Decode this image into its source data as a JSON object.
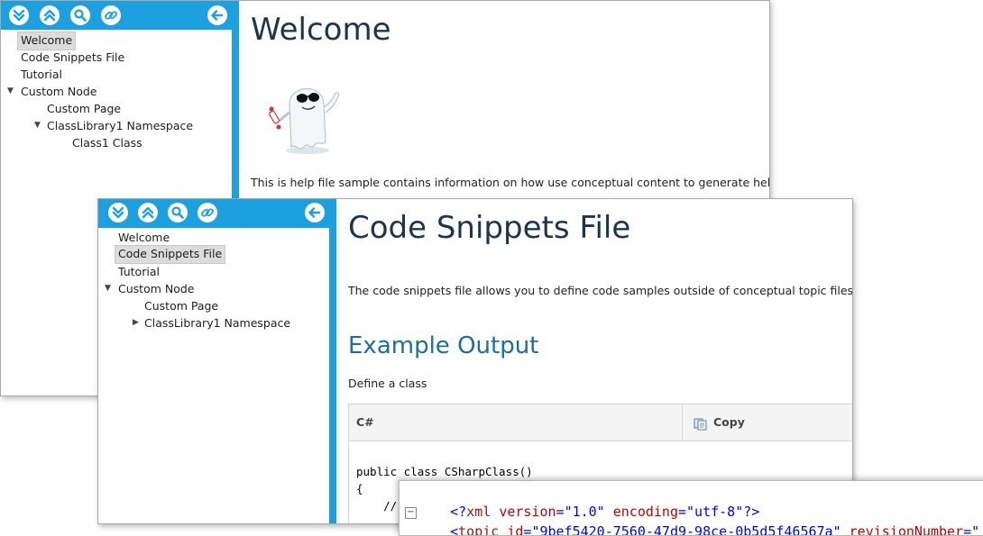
{
  "window_back": {
    "toolbar": {
      "buttons": [
        {
          "icon": "expand-all-icon"
        },
        {
          "icon": "collapse-all-icon"
        },
        {
          "icon": "search-icon"
        },
        {
          "icon": "link-icon"
        }
      ],
      "back_icon": "back-arrow-icon"
    },
    "tree": [
      {
        "label": "Welcome",
        "selected": true
      },
      {
        "label": "Code Snippets File"
      },
      {
        "label": "Tutorial"
      },
      {
        "label": "Custom Node",
        "expanded": true
      },
      {
        "label": "Custom Page"
      },
      {
        "label": "ClassLibrary1 Namespace",
        "expanded": true
      },
      {
        "label": "Class1 Class"
      }
    ],
    "content": {
      "title": "Welcome",
      "image": "ghost-mascot",
      "paragraph": "This is help file sample contains information on how use conceptual content to generate help file."
    }
  },
  "window_front": {
    "toolbar": {
      "buttons": [
        {
          "icon": "expand-all-icon"
        },
        {
          "icon": "collapse-all-icon"
        },
        {
          "icon": "search-icon"
        },
        {
          "icon": "link-icon"
        }
      ],
      "back_icon": "back-arrow-icon"
    },
    "tree": [
      {
        "label": "Welcome"
      },
      {
        "label": "Code Snippets File",
        "selected": true
      },
      {
        "label": "Tutorial"
      },
      {
        "label": "Custom Node",
        "expanded": true
      },
      {
        "label": "Custom Page"
      },
      {
        "label": "ClassLibrary1 Namespace",
        "expanded": false
      }
    ],
    "content": {
      "title": "Code Snippets File",
      "intro": "The code snippets file allows you to define code samples outside of conceptual topic files.",
      "section_title": "Example Output",
      "section_text": "Define a class",
      "code_block": {
        "language": "C#",
        "copy_label": "Copy",
        "lines": [
          "public class CSharpClass()",
          "{",
          "    //"
        ]
      }
    }
  },
  "xml_window": {
    "line1": {
      "open": "<?",
      "name": "xml",
      "attr1": "version",
      "val1": "\"1.0\"",
      "attr2": "encoding",
      "val2": "\"utf-8\"",
      "close": "?>"
    },
    "line2": {
      "open": "<",
      "name": "topic",
      "attr1": "id",
      "val1": "\"9bef5420-7560-47d9-98ce-0b5d5f46567a\"",
      "attr2": "revisionNumber",
      "val2": "=\""
    },
    "collapse_glyph": "−"
  },
  "colors": {
    "accent": "#1ca0e0",
    "title": "#1a3550",
    "section_title": "#1c6e9e"
  }
}
